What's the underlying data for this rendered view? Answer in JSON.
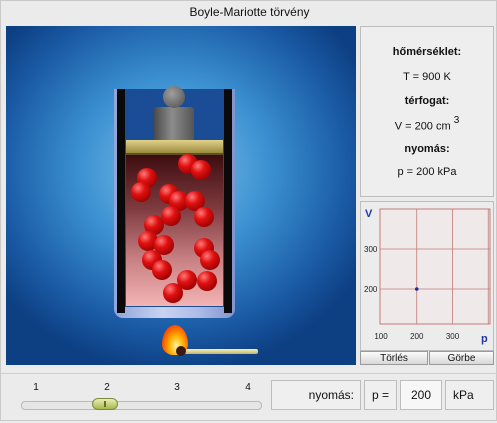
{
  "window": {
    "title": "Boyle-Mariotte törvény"
  },
  "info": {
    "temperature_label": "hőmérséklet:",
    "temperature_value": "T = 900 K",
    "volume_label": "térfogat:",
    "volume_value": "V = 200 cm",
    "volume_exponent": "3",
    "pressure_label": "nyomás:",
    "pressure_value": "p = 200 kPa"
  },
  "graph": {
    "y_axis_title": "V",
    "x_axis_title": "p",
    "y_ticks": [
      "300",
      "200"
    ],
    "x_ticks": [
      "100",
      "200",
      "300"
    ],
    "point": {
      "p": 200,
      "V": 200
    },
    "colors": {
      "axis_title": "#1e3aa8",
      "grid": "#c47a7a",
      "point": "#1a2a9a"
    }
  },
  "buttons": {
    "clear_label": "Törlés",
    "curve_label": "Görbe"
  },
  "controls": {
    "slider_ticks": [
      "1",
      "2",
      "3",
      "4"
    ],
    "slider_value": 2,
    "pressure_caption": "nyomás:",
    "p_label": "p =",
    "p_value": "200",
    "unit": "kPa"
  }
}
